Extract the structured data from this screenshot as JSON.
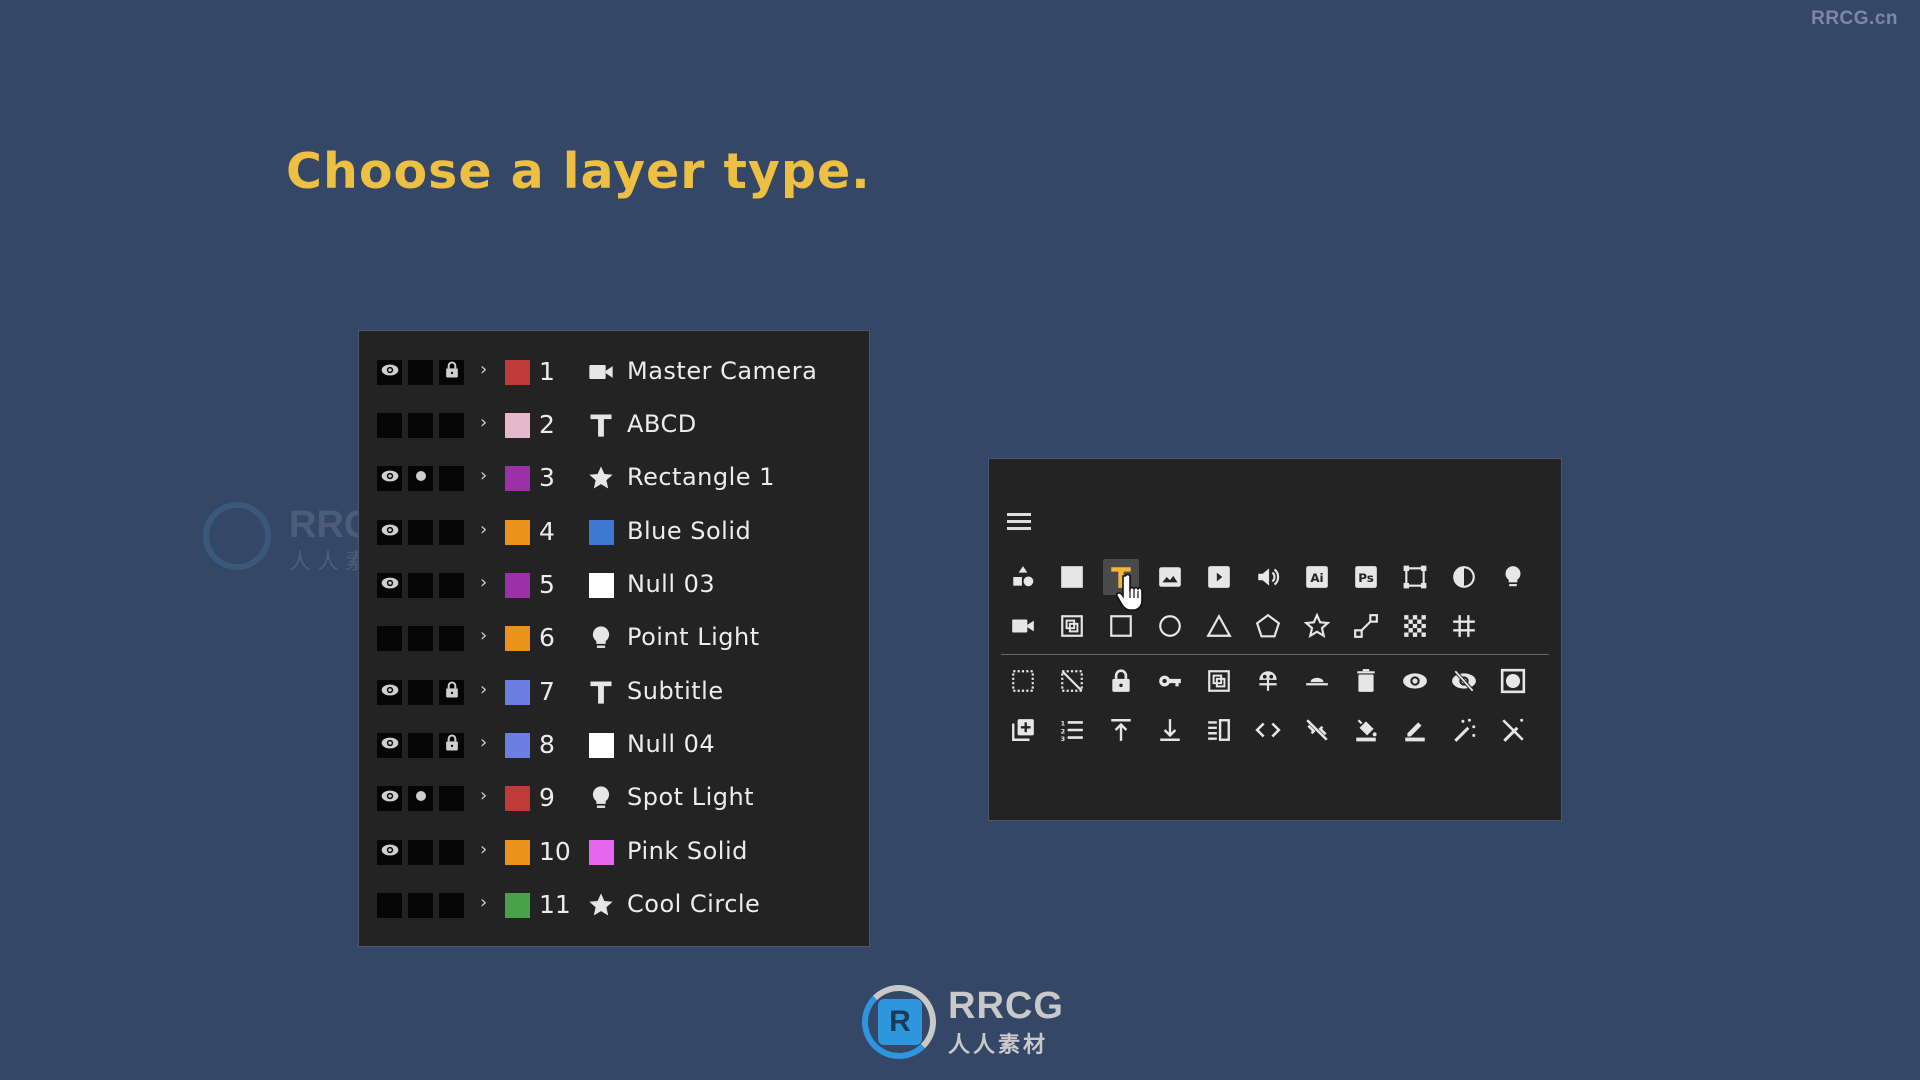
{
  "watermark_top": "RRCG.cn",
  "title": "Choose a layer type.",
  "watermark_left": {
    "latin": "RRCG",
    "cn": "人人素材"
  },
  "logo": {
    "mark": "R",
    "latin": "RRCG",
    "cn": "人人素材"
  },
  "colors": {
    "background": "#344766",
    "title": "#edc043",
    "panel": "#232323",
    "accent_selected": "#f0b63a"
  },
  "layers": [
    {
      "num": "1",
      "name": "Master Camera",
      "label_color": "#c03a3a",
      "type_icon": "camera-icon",
      "visible": true,
      "solo": false,
      "locked": true
    },
    {
      "num": "2",
      "name": "ABCD",
      "label_color": "#e6b8cc",
      "type_icon": "text-icon",
      "visible": false,
      "solo": false,
      "locked": false
    },
    {
      "num": "3",
      "name": "Rectangle 1",
      "label_color": "#9b30a8",
      "type_icon": "star-icon",
      "visible": true,
      "solo": true,
      "locked": false
    },
    {
      "num": "4",
      "name": "Blue Solid",
      "label_color": "#ea9318",
      "type_icon": "solid-blue-icon",
      "swatch": "#3f78d2",
      "visible": true,
      "solo": false,
      "locked": false
    },
    {
      "num": "5",
      "name": "Null 03",
      "label_color": "#9b30a8",
      "type_icon": "null-icon",
      "swatch": "#ffffff",
      "visible": true,
      "solo": false,
      "locked": false
    },
    {
      "num": "6",
      "name": "Point Light",
      "label_color": "#ea9318",
      "type_icon": "light-bulb-icon",
      "visible": false,
      "solo": false,
      "locked": false
    },
    {
      "num": "7",
      "name": "Subtitle",
      "label_color": "#6a7fe0",
      "type_icon": "text-icon",
      "visible": true,
      "solo": false,
      "locked": true
    },
    {
      "num": "8",
      "name": "Null 04",
      "label_color": "#6a7fe0",
      "type_icon": "null-icon",
      "swatch": "#ffffff",
      "visible": true,
      "solo": false,
      "locked": true
    },
    {
      "num": "9",
      "name": "Spot Light",
      "label_color": "#c03a3a",
      "type_icon": "light-bulb-icon",
      "visible": true,
      "solo": true,
      "locked": false
    },
    {
      "num": "10",
      "name": "Pink Solid",
      "label_color": "#ea9318",
      "type_icon": "solid-pink-icon",
      "swatch": "#e766ef",
      "visible": true,
      "solo": false,
      "locked": false
    },
    {
      "num": "11",
      "name": "Cool Circle",
      "label_color": "#47a24a",
      "type_icon": "star-icon",
      "visible": false,
      "solo": false,
      "locked": false
    }
  ],
  "icon_panel": {
    "menu_icon": "hamburger-menu-icon",
    "selected": "text-layer-icon",
    "rows": [
      [
        "shapes-icon",
        "solid-layer-icon",
        "text-layer-icon",
        "image-icon",
        "video-icon",
        "audio-icon",
        "illustrator-icon",
        "photoshop-icon",
        "transform-box-icon",
        "adjustment-icon",
        "light-icon"
      ],
      [
        "camera-icon",
        "precomp-icon",
        "rectangle-icon",
        "ellipse-icon",
        "triangle-icon",
        "pentagon-icon",
        "star-outline-icon",
        "path-icon",
        "transparency-grid-icon",
        "grid-icon"
      ],
      [
        "selection-icon",
        "deselect-icon",
        "lock-icon",
        "keyframe-key-icon",
        "precompose-icon",
        "parent-icon",
        "horizon-icon",
        "trash-icon",
        "eye-icon",
        "eye-off-icon",
        "mask-icon"
      ],
      [
        "duplicate-icon",
        "numbered-list-icon",
        "move-to-top-icon",
        "move-to-bottom-icon",
        "align-icon",
        "code-icon",
        "unlink-icon",
        "fill-icon",
        "stroke-icon",
        "magic-wand-icon",
        "remove-effects-icon"
      ]
    ],
    "ai_text": "Ai",
    "ps_text": "Ps"
  }
}
